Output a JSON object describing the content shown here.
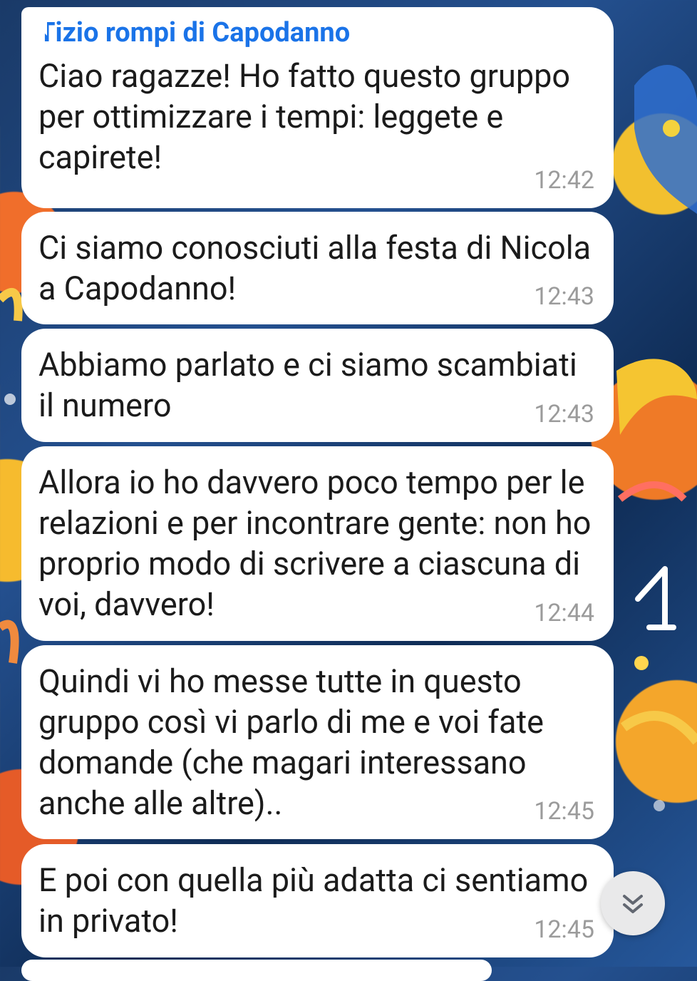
{
  "chat": {
    "messages": [
      {
        "sender": "Tizio rompi di Capodanno",
        "text": "Ciao ragazze! Ho fatto questo gruppo per ottimizzare i tempi: leggete e capirete!",
        "time": "12:42"
      },
      {
        "text": "Ci siamo conosciuti alla festa di Nicola a Capodanno!",
        "time": "12:43"
      },
      {
        "text": "Abbiamo parlato e ci siamo scambiati il numero",
        "time": "12:43"
      },
      {
        "text": "Allora io ho davvero poco tempo per le relazioni e per incontrare gente: non ho proprio modo di scrivere a ciascuna di voi, davvero!",
        "time": "12:44"
      },
      {
        "text": "Quindi vi ho messe tutte in questo gruppo così vi parlo di me e voi fate domande (che magari interessano anche alle altre)..",
        "time": "12:45"
      },
      {
        "text": "E poi con quella più adatta ci sentiamo in privato!",
        "time": "12:45"
      }
    ]
  },
  "colors": {
    "sender_name": "#1a73e8",
    "bubble": "#ffffff",
    "timestamp": "#9b9b9b",
    "annotation": "#ffffff"
  },
  "icons": {
    "scroll_down": "double-chevron-down-icon"
  }
}
